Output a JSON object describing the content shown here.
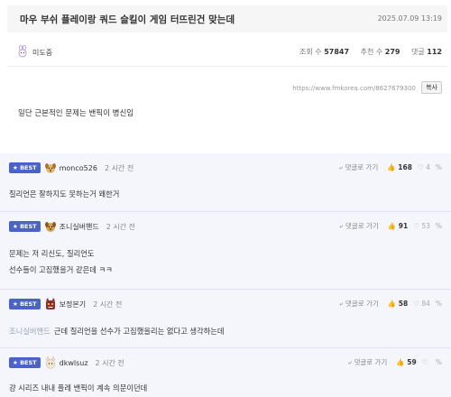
{
  "post": {
    "title": "마우 부쉬 플레이랑 쿼드 슬킬이 게임 터뜨린건 맞는데",
    "date": "2025.07.09 13:19",
    "author": "미도중",
    "stats": {
      "views_label": "조회 수",
      "views": "57847",
      "recommend_label": "추천 수",
      "recommend": "279",
      "comments_label": "댓글",
      "comments": "112"
    },
    "url": "https://www.fmkorea.com/8627679300",
    "copy_label": "복사",
    "body": "일단 근본적인 문제는 밴픽이 병신임"
  },
  "comments": [
    {
      "badge": "BEST",
      "author": "monco526",
      "time": "2 시간 전",
      "reply_label": "댓글로 가기",
      "up": "168",
      "down": "4",
      "pct": "%",
      "lines": [
        "질리언은 잘하지도 못하는거 왜한거"
      ]
    },
    {
      "badge": "BEST",
      "author": "조니실버핸드",
      "time": "2 시간 전",
      "reply_label": "댓글로 가기",
      "up": "91",
      "down": "53",
      "pct": "%",
      "lines": [
        "문제는 저 리신도, 질리언도",
        "선수들이 고집했을거 같은데 ㅋㅋ"
      ]
    },
    {
      "badge": "BEST",
      "author": "보정본기",
      "time": "2 시간 전",
      "reply_label": "댓글로 가기",
      "up": "58",
      "down": "84",
      "pct": "%",
      "mention": "조니실버핸드",
      "lines": [
        "근데 질리언을 선수가 고집했을리는 없다고 생각하는데"
      ]
    },
    {
      "badge": "BEST",
      "author": "dkwlsuz",
      "time": "2 시간 전",
      "reply_label": "댓글로 가기",
      "up": "59",
      "down": "",
      "pct": "%",
      "lines": [
        "걍 시리즈 내내 플레 밴픽이 계속 의문이던데"
      ]
    }
  ],
  "colors": {
    "best_badge": "#4a63c6",
    "comment_bg": "#f4f6fc"
  },
  "icons": [
    "rabbit-avatar-icon",
    "dog-avatar-icon",
    "monster-avatar-icon",
    "cat-avatar-icon",
    "reply-arrow-icon",
    "thumb-up-icon",
    "thumb-down-icon"
  ]
}
